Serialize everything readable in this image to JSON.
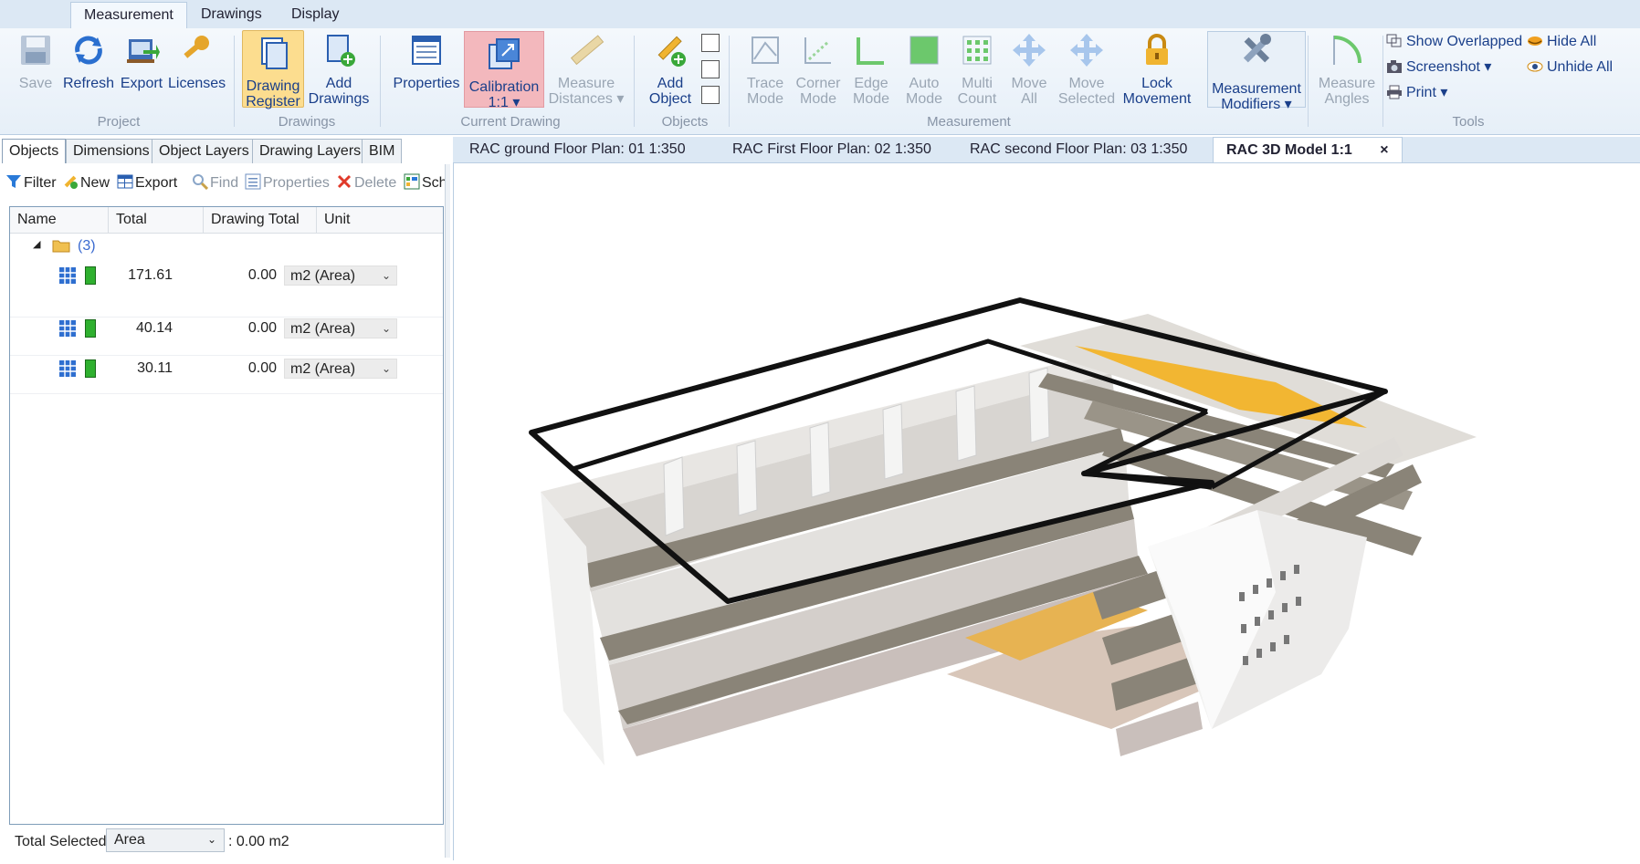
{
  "ribbon_tabs": [
    {
      "label": "Measurement",
      "active": true
    },
    {
      "label": "Drawings"
    },
    {
      "label": "Display"
    }
  ],
  "project": {
    "group": "Project",
    "save": "Save",
    "refresh": "Refresh",
    "export": "Export",
    "licenses": "Licenses"
  },
  "drawings": {
    "group": "Drawings",
    "register_1": "Drawing",
    "register_2": "Register",
    "add_1": "Add",
    "add_2": "Drawings"
  },
  "current_drawing": {
    "group": "Current Drawing",
    "properties": "Properties",
    "calibration_1": "Calibration",
    "calibration_2": "1:1 ▾",
    "measure_1": "Measure",
    "measure_2": "Distances ▾"
  },
  "objects": {
    "group": "Objects",
    "add_1": "Add",
    "add_2": "Object"
  },
  "measurement": {
    "group": "Measurement",
    "trace_1": "Trace",
    "trace_2": "Mode",
    "corner_1": "Corner",
    "corner_2": "Mode",
    "edge_1": "Edge",
    "edge_2": "Mode",
    "auto_1": "Auto",
    "auto_2": "Mode",
    "multi_1": "Multi",
    "multi_2": "Count",
    "moveall_1": "Move",
    "moveall_2": "All",
    "movesel_1": "Move",
    "movesel_2": "Selected",
    "lock_1": "Lock",
    "lock_2": "Movement"
  },
  "modifiers": {
    "line1": "Measurement",
    "line2": "Modifiers ▾"
  },
  "angles": {
    "line1": "Measure",
    "line2": "Angles"
  },
  "tools": {
    "group": "Tools",
    "show_overlapped": "Show Overlapped",
    "screenshot": "Screenshot ▾",
    "print": "Print ▾",
    "hide_all": "Hide All",
    "unhide_all": "Unhide All"
  },
  "panel_tabs": [
    "Objects",
    "Dimensions",
    "Object Layers",
    "Drawing Layers",
    "BIM"
  ],
  "drawing_tabs": [
    "RAC ground Floor Plan: 01  1:350",
    "RAC First Floor Plan: 02 1:350",
    "RAC second Floor Plan: 03 1:350",
    "RAC 3D Model 1:1"
  ],
  "close_glyph": "×",
  "toolbar": {
    "filter": "Filter",
    "new": "New",
    "export": "Export",
    "find": "Find",
    "properties": "Properties",
    "delete": "Delete",
    "sch": "Sch"
  },
  "grid": {
    "headers": {
      "name": "Name",
      "total": "Total",
      "drawing_total": "Drawing Total",
      "unit": "Unit"
    },
    "group_label": "(3)",
    "rows": [
      {
        "total": "171.61",
        "drawing_total": "0.00",
        "unit": "m2 (Area)"
      },
      {
        "total": "40.14",
        "drawing_total": "0.00",
        "unit": "m2 (Area)"
      },
      {
        "total": "30.11",
        "drawing_total": "0.00",
        "unit": "m2 (Area)"
      }
    ]
  },
  "footer": {
    "label": "Total Selected",
    "select": "Area",
    "value": ": 0.00 m2"
  },
  "colors": {
    "accent": "#1a3f8a",
    "highlight": "#fcdd8f",
    "floor_highlight": "#f2b632",
    "object_green": "#2fb02f"
  }
}
